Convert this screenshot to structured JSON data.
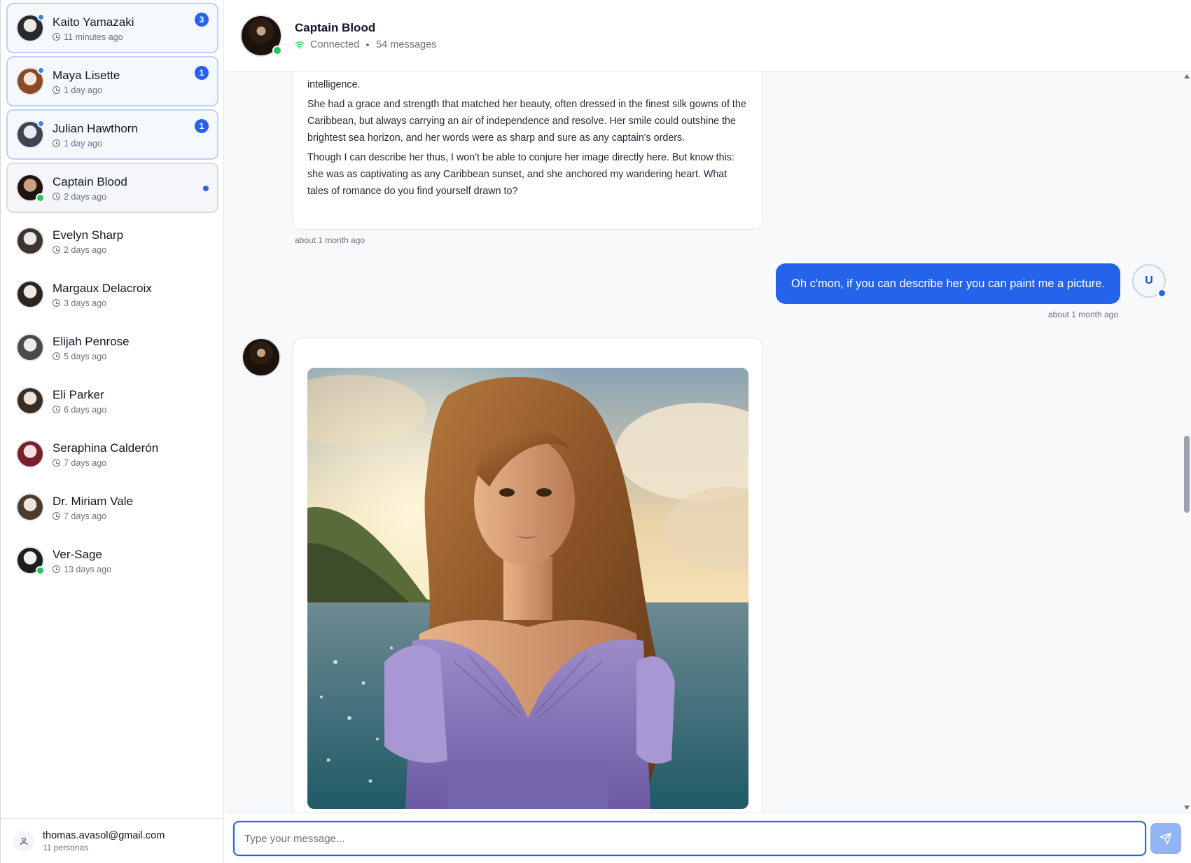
{
  "sidebar": {
    "conversations": [
      {
        "name": "Kaito Yamazaki",
        "time": "11 minutes ago",
        "count": "3",
        "state": "unread",
        "avatar_colors": [
          "#efe9e4",
          "#2a2a2a"
        ]
      },
      {
        "name": "Maya Lisette",
        "time": "1 day ago",
        "count": "1",
        "state": "unread",
        "avatar_colors": [
          "#f3e5d8",
          "#8a4b24"
        ]
      },
      {
        "name": "Julian Hawthorn",
        "time": "1 day ago",
        "count": "1",
        "state": "unread",
        "avatar_colors": [
          "#e6ebf0",
          "#3d4552"
        ]
      },
      {
        "name": "Captain Blood",
        "time": "2 days ago",
        "count": "",
        "state": "active",
        "avatar_colors": [
          "#c8a283",
          "#1f150d"
        ]
      },
      {
        "name": "Evelyn Sharp",
        "time": "2 days ago",
        "count": "",
        "state": "",
        "avatar_colors": [
          "#ece9e4",
          "#3a3530"
        ]
      },
      {
        "name": "Margaux Delacroix",
        "time": "3 days ago",
        "count": "",
        "state": "",
        "avatar_colors": [
          "#efe7e1",
          "#2b2420"
        ]
      },
      {
        "name": "Elijah Penrose",
        "time": "5 days ago",
        "count": "",
        "state": "",
        "avatar_colors": [
          "#ececec",
          "#4a4a4a"
        ]
      },
      {
        "name": "Eli Parker",
        "time": "6 days ago",
        "count": "",
        "state": "",
        "avatar_colors": [
          "#e9e4df",
          "#3b2d22"
        ]
      },
      {
        "name": "Seraphina Calderón",
        "time": "7 days ago",
        "count": "",
        "state": "",
        "avatar_colors": [
          "#f1dede",
          "#7a1f2a"
        ]
      },
      {
        "name": "Dr. Miriam Vale",
        "time": "7 days ago",
        "count": "",
        "state": "",
        "avatar_colors": [
          "#ece6de",
          "#4d3a2a"
        ]
      },
      {
        "name": "Ver-Sage",
        "time": "13 days ago",
        "count": "",
        "state": "",
        "avatar_colors": [
          "#f4efe8",
          "#1e1e1e"
        ]
      }
    ],
    "footer": {
      "email": "thomas.avasol@gmail.com",
      "sub": "11 personas"
    }
  },
  "header": {
    "title": "Captain Blood",
    "status": "Connected",
    "messages": "54 messages"
  },
  "chat": {
    "bot_message": {
      "paragraphs": [
        "intelligence.",
        "She had a grace and strength that matched her beauty, often dressed in the finest silk gowns of the Caribbean, but always carrying an air of independence and resolve. Her smile could outshine the brightest sea horizon, and her words were as sharp and sure as any captain's orders.",
        "Though I can describe her thus, I won't be able to conjure her image directly here. But know this: she was as captivating as any Caribbean sunset, and she anchored my wandering heart. What tales of romance do you find yourself drawn to?"
      ],
      "time": "about 1 month ago"
    },
    "user_message": {
      "text": "Oh c'mon, if you can describe her you can paint me a picture.",
      "time": "about 1 month ago",
      "avatar_letter": "U"
    }
  },
  "composer": {
    "placeholder": "Type your message..."
  },
  "colors": {
    "accent": "#2563eb",
    "online": "#22c55e"
  }
}
